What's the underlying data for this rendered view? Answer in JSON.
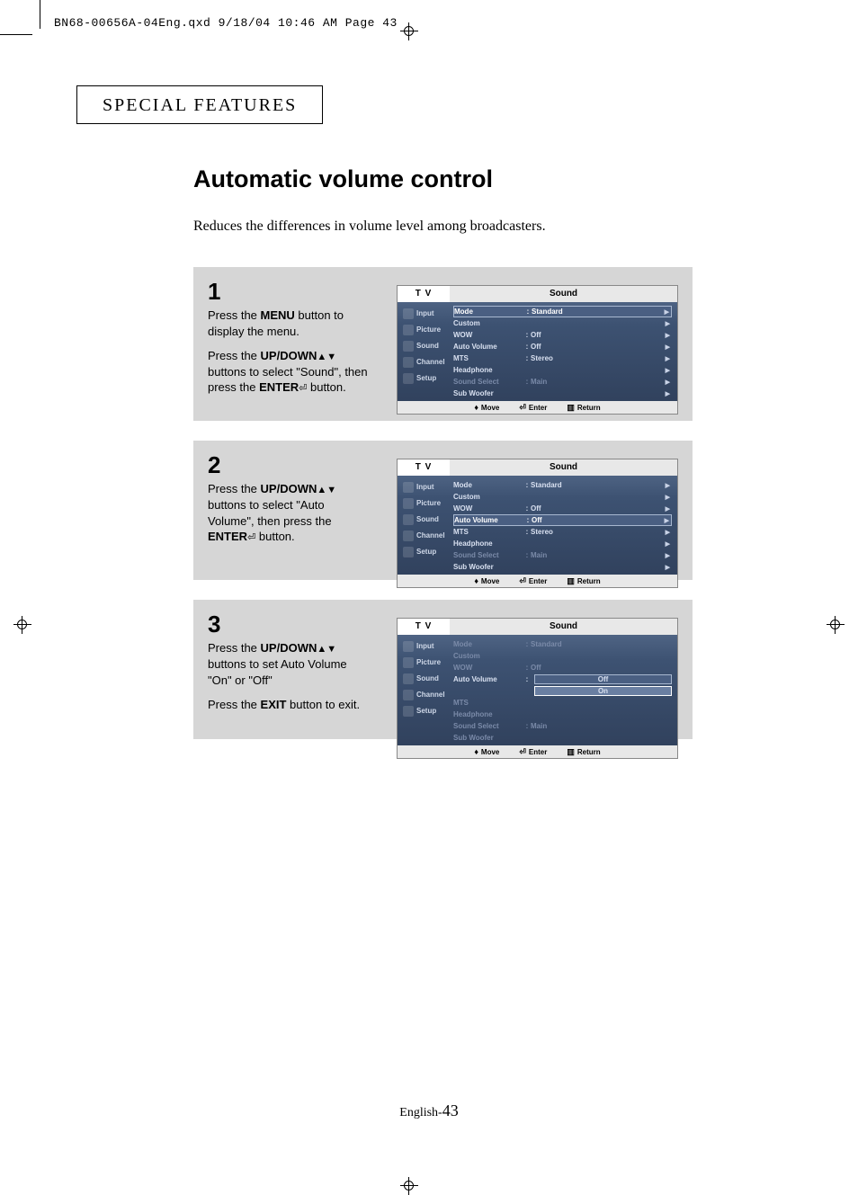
{
  "print_header": "BN68-00656A-04Eng.qxd  9/18/04 10:46 AM  Page 43",
  "section_title": "SPECIAL FEATURES",
  "main_title": "Automatic volume control",
  "intro": "Reduces the differences in volume level among broadcasters.",
  "steps": [
    {
      "num": "1",
      "paragraphs": [
        {
          "segments": [
            {
              "t": "Press the "
            },
            {
              "t": "MENU",
              "b": true
            },
            {
              "t": " button to display the menu."
            }
          ]
        },
        {
          "segments": [
            {
              "t": "Press the "
            },
            {
              "t": "UP/DOWN",
              "b": true
            },
            {
              "t": " ",
              "arrows": true
            },
            {
              "t": " buttons to select \"Sound\", then press the "
            },
            {
              "t": "ENTER",
              "b": true
            },
            {
              "t": " ",
              "enter": true
            },
            {
              "t": " button."
            }
          ]
        }
      ]
    },
    {
      "num": "2",
      "paragraphs": [
        {
          "segments": [
            {
              "t": "Press the "
            },
            {
              "t": "UP/DOWN",
              "b": true
            },
            {
              "t": " ",
              "arrows": true
            },
            {
              "t": " buttons to select \"Auto Volume\", then press the "
            },
            {
              "t": "ENTER",
              "b": true
            },
            {
              "t": " ",
              "enter": true
            },
            {
              "t": " button."
            }
          ]
        }
      ]
    },
    {
      "num": "3",
      "paragraphs": [
        {
          "segments": [
            {
              "t": "Press the "
            },
            {
              "t": "UP/DOWN",
              "b": true
            },
            {
              "t": " ",
              "arrows": true
            },
            {
              "t": " buttons  to set Auto Volume \"On\" or \"Off\""
            }
          ]
        },
        {
          "segments": [
            {
              "t": "Press the "
            },
            {
              "t": "EXIT",
              "b": true
            },
            {
              "t": " button to exit."
            }
          ]
        }
      ]
    }
  ],
  "osd": {
    "tv": "T V",
    "title": "Sound",
    "side": [
      "Input",
      "Picture",
      "Sound",
      "Channel",
      "Setup"
    ],
    "footer": {
      "move": "Move",
      "enter": "Enter",
      "return": "Return"
    },
    "screens": [
      {
        "rows": [
          {
            "label": "Mode",
            "val": "Standard",
            "hl": true,
            "arr": true
          },
          {
            "label": "Custom",
            "val": "",
            "arr": true
          },
          {
            "label": "WOW",
            "val": "Off",
            "arr": true
          },
          {
            "label": "Auto Volume",
            "val": "Off",
            "arr": true
          },
          {
            "label": "MTS",
            "val": "Stereo",
            "arr": true
          },
          {
            "label": "Headphone",
            "val": "",
            "arr": true
          },
          {
            "label": "Sound Select",
            "val": "Main",
            "arr": true,
            "dim": true
          },
          {
            "label": "Sub Woofer",
            "val": "",
            "arr": true
          }
        ]
      },
      {
        "rows": [
          {
            "label": "Mode",
            "val": "Standard",
            "arr": true
          },
          {
            "label": "Custom",
            "val": "",
            "arr": true
          },
          {
            "label": "WOW",
            "val": "Off",
            "arr": true
          },
          {
            "label": "Auto Volume",
            "val": "Off",
            "hl": true,
            "arr": true
          },
          {
            "label": "MTS",
            "val": "Stereo",
            "arr": true
          },
          {
            "label": "Headphone",
            "val": "",
            "arr": true
          },
          {
            "label": "Sound Select",
            "val": "Main",
            "arr": true,
            "dim": true
          },
          {
            "label": "Sub Woofer",
            "val": "",
            "arr": true
          }
        ]
      },
      {
        "rows": [
          {
            "label": "Mode",
            "val": "Standard",
            "dim": true
          },
          {
            "label": "Custom",
            "val": "",
            "dim": true
          },
          {
            "label": "WOW",
            "val": "Off",
            "dim": true
          },
          {
            "label": "Auto Volume",
            "val": "Off",
            "expanded": true
          },
          {
            "label": "",
            "val": "On",
            "expanded": true,
            "hl_val": true
          },
          {
            "label": "MTS",
            "val": "",
            "dim": true
          },
          {
            "label": "Headphone",
            "val": "",
            "dim": true
          },
          {
            "label": "Sound Select",
            "val": "Main",
            "dim": true
          },
          {
            "label": "Sub Woofer",
            "val": "",
            "dim": true
          }
        ]
      }
    ]
  },
  "page_num_prefix": "English-",
  "page_num": "43"
}
